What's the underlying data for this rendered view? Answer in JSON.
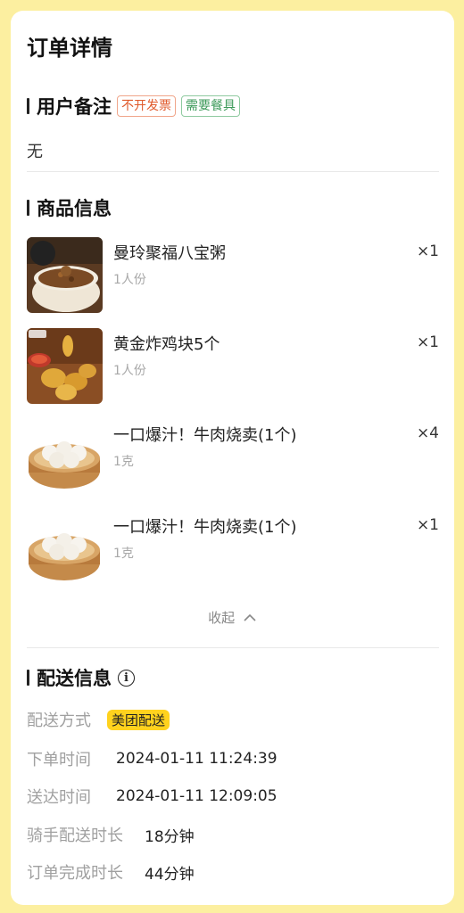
{
  "header": {
    "title": "订单详情"
  },
  "remarks": {
    "section_title": "用户备注",
    "tags": [
      "不开发票",
      "需要餐具"
    ],
    "text": "无"
  },
  "goods": {
    "section_title": "商品信息",
    "items": [
      {
        "name": "曼玲聚福八宝粥",
        "spec": "1人份",
        "qty": "×1",
        "image": "congee-bowl"
      },
      {
        "name": "黄金炸鸡块5个",
        "spec": "1人份",
        "qty": "×1",
        "image": "fried-chicken-nuggets"
      },
      {
        "name": "一口爆汁！牛肉烧卖(1个)",
        "spec": "1克",
        "qty": "×4",
        "image": "shumai-steamer"
      },
      {
        "name": "一口爆汁！牛肉烧卖(1个)",
        "spec": "1克",
        "qty": "×1",
        "image": "shumai-steamer"
      }
    ],
    "collapse_label": "收起"
  },
  "delivery": {
    "section_title": "配送信息",
    "rows": [
      {
        "label": "配送方式",
        "value": "美团配送"
      },
      {
        "label": "下单时间",
        "value": "2024-01-11 11:24:39"
      },
      {
        "label": "送达时间",
        "value": "2024-01-11 12:09:05"
      },
      {
        "label": "骑手配送时长",
        "value": "18分钟"
      },
      {
        "label": "订单完成时长",
        "value": "44分钟"
      }
    ]
  },
  "colors": {
    "page_background": "#fcefa0",
    "badge_yellow": "#ffd21e",
    "tag_invoice": "#e05a2b",
    "tag_utensil": "#3d9a5a"
  }
}
